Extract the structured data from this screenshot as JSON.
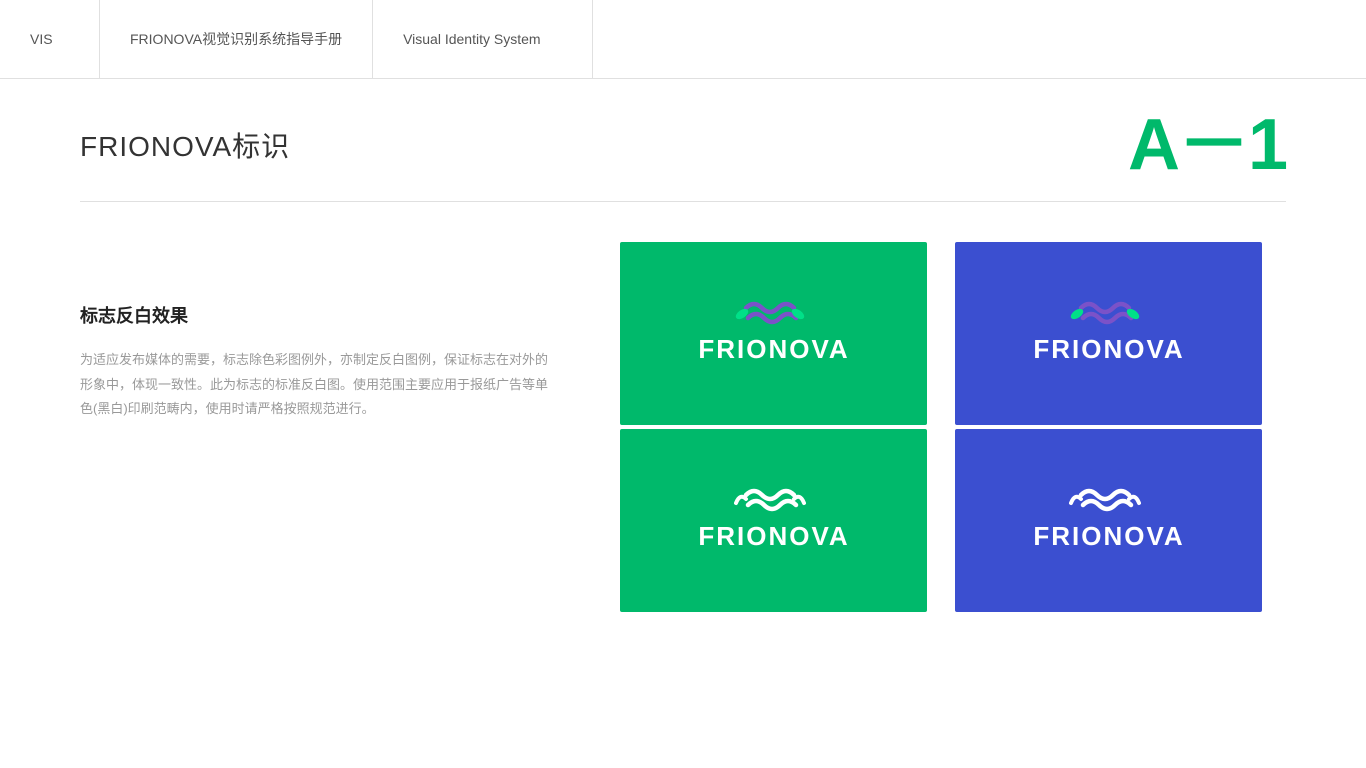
{
  "header": {
    "vis_label": "VIS",
    "guide_label": "FRIONOVA视觉识别系统指导手册",
    "vis_system_label": "Visual Identity System"
  },
  "section": {
    "title": "FRIONOVA标识",
    "code": "A－1"
  },
  "content": {
    "block_title": "标志反白效果",
    "block_desc": "为适应发布媒体的需要，标志除色彩图例外，亦制定反白图例，保证标志在对外的形象中，体现一致性。此为标志的标准反白图。使用范围主要应用于报纸广告等单色(黑白)印刷范畴内，使用时请严格按照规范进行。"
  },
  "colors": {
    "green": "#00b96b",
    "blue": "#3b4fd0",
    "white": "#ffffff",
    "text_dark": "#333333",
    "text_light": "#999999"
  },
  "logo_cells": [
    {
      "bg": "green",
      "variant": "color",
      "position": "top-left"
    },
    {
      "bg": "blue",
      "variant": "color",
      "position": "top-right"
    },
    {
      "bg": "green",
      "variant": "white",
      "position": "bottom-left"
    },
    {
      "bg": "blue",
      "variant": "white",
      "position": "bottom-right"
    }
  ]
}
